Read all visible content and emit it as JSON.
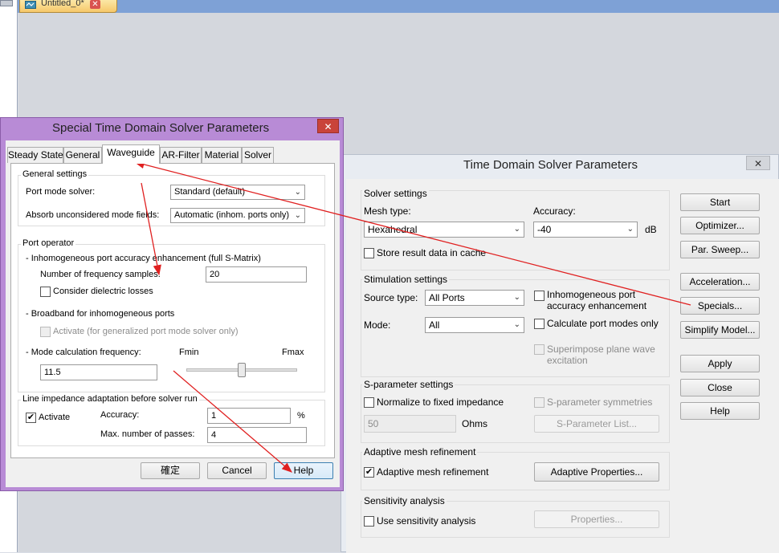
{
  "host": {
    "doc_tab_label": "Untitled_0*",
    "doc_tab_close": "✕"
  },
  "special_dialog": {
    "title": "Special Time Domain Solver Parameters",
    "close": "✕",
    "tabs": [
      "Steady State",
      "General",
      "Waveguide",
      "AR-Filter",
      "Material",
      "Solver"
    ],
    "active_tab": "Waveguide",
    "general_settings": {
      "title": "General settings",
      "port_mode_solver_label": "Port mode solver:",
      "port_mode_solver_value": "Standard (default)",
      "absorb_label": "Absorb unconsidered mode fields:",
      "absorb_value": "Automatic (inhom. ports only)"
    },
    "port_operator": {
      "title": "Port operator",
      "inhom_heading": "- Inhomogeneous port accuracy enhancement (full S-Matrix)",
      "num_freq_label": "Number of frequency samples:",
      "num_freq_value": "20",
      "dielectric_label": "Consider dielectric losses",
      "broadband_heading": "- Broadband for inhomogeneous ports",
      "activate_label": "Activate (for generalized port mode solver only)",
      "mode_calc_label": "- Mode calculation frequency:",
      "fmin": "Fmin",
      "fmax": "Fmax",
      "mode_calc_value": "11.5",
      "slider_fraction": 0.5
    },
    "line_impedance": {
      "title": "Line impedance adaptation before solver run",
      "activate_label": "Activate",
      "activate_checked": "✔",
      "accuracy_label": "Accuracy:",
      "accuracy_value": "1",
      "accuracy_unit": "%",
      "passes_label": "Max. number of passes:",
      "passes_value": "4"
    },
    "buttons": {
      "ok": "確定",
      "cancel": "Cancel",
      "help": "Help"
    }
  },
  "td_dialog": {
    "title": "Time Domain Solver Parameters",
    "close": "✕",
    "solver_settings": {
      "title": "Solver settings",
      "mesh_type_label": "Mesh type:",
      "mesh_type_value": "Hexahedral",
      "accuracy_label": "Accuracy:",
      "accuracy_value": "-40",
      "accuracy_unit": "dB",
      "store_cache_label": "Store result data in cache"
    },
    "stimulation": {
      "title": "Stimulation settings",
      "source_label": "Source type:",
      "source_value": "All Ports",
      "mode_label": "Mode:",
      "mode_value": "All",
      "inhom_label_1": "Inhomogeneous port",
      "inhom_label_2": "accuracy enhancement",
      "calc_modes_label": "Calculate port modes only",
      "superimpose_label_1": "Superimpose plane wave",
      "superimpose_label_2": "excitation"
    },
    "sparam": {
      "title": "S-parameter settings",
      "normalize_label": "Normalize to fixed impedance",
      "symmetries_label": "S-parameter symmetries",
      "impedance_value": "50",
      "ohms": "Ohms",
      "list_button": "S-Parameter List..."
    },
    "adaptive": {
      "title": "Adaptive mesh refinement",
      "checkbox_label": "Adaptive mesh refinement",
      "checked": "✔",
      "properties_button": "Adaptive Properties..."
    },
    "sensitivity": {
      "title": "Sensitivity analysis",
      "checkbox_label": "Use sensitivity analysis",
      "properties_button": "Properties..."
    },
    "side_buttons": {
      "start": "Start",
      "optimizer": "Optimizer...",
      "par_sweep": "Par. Sweep...",
      "acceleration": "Acceleration...",
      "specials": "Specials...",
      "simplify": "Simplify Model...",
      "apply": "Apply",
      "close": "Close",
      "help": "Help"
    }
  },
  "colors": {
    "annotation_arrow": "#e02020",
    "special_dialog_frame": "#b88bd6"
  }
}
